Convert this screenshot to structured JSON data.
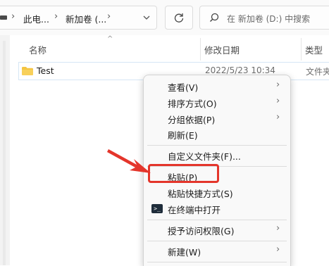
{
  "address_bar": {
    "segments": [
      "此电...",
      "新加卷 (..."
    ],
    "chevron": "chevron-down-icon"
  },
  "search": {
    "placeholder": "在 新加卷 (D:) 中搜索"
  },
  "columns": {
    "name": "名称",
    "date": "修改日期",
    "type": "类型"
  },
  "rows": [
    {
      "name": "Test",
      "date": "2022/5/23 10:34",
      "type": "文件夹"
    }
  ],
  "context_menu": {
    "items": [
      {
        "label": "查看(V)",
        "submenu": true
      },
      {
        "label": "排序方式(O)",
        "submenu": true
      },
      {
        "label": "分组依据(P)",
        "submenu": true
      },
      {
        "label": "刷新(E)",
        "submenu": false
      },
      {
        "label": "自定义文件夹(F)...",
        "submenu": false
      },
      {
        "label": "粘贴(P)",
        "submenu": false
      },
      {
        "label": "粘贴快捷方式(S)",
        "submenu": false
      },
      {
        "label": "在终端中打开",
        "submenu": false,
        "icon": "terminal-icon"
      },
      {
        "label": "授予访问权限(G)",
        "submenu": true
      },
      {
        "label": "新建(W)",
        "submenu": true
      }
    ]
  },
  "colors": {
    "highlight": "#e4352b",
    "folder": "#f4c542"
  }
}
